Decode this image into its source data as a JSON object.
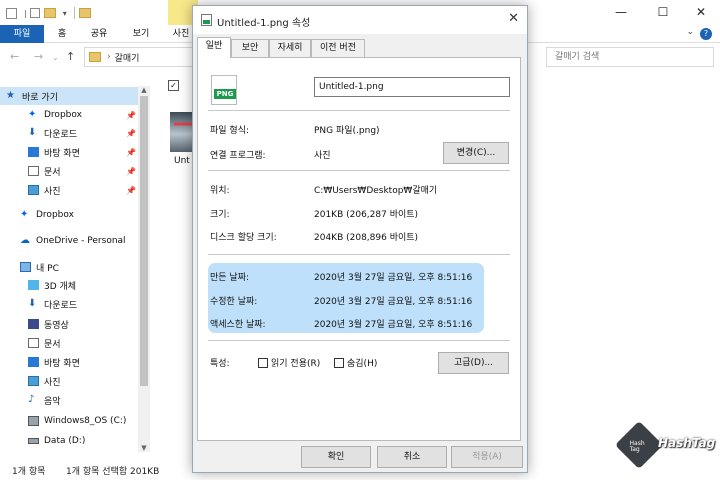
{
  "explorer": {
    "ribbon_tabs": [
      "파일",
      "홈",
      "공유",
      "보기",
      "사진"
    ],
    "address_crumb": "갈매기",
    "search_placeholder": "갈매기 검색",
    "nav": {
      "quick_access": "바로 가기",
      "quick_items": [
        "Dropbox",
        "다운로드",
        "바탕 화면",
        "문서",
        "사진"
      ],
      "dropbox": "Dropbox",
      "onedrive": "OneDrive - Personal",
      "this_pc": "내 PC",
      "pc_items": [
        "3D 개체",
        "다운로드",
        "동영상",
        "문서",
        "바탕 화면",
        "사진",
        "음악",
        "Windows8_OS (C:)",
        "Data (D:)"
      ]
    },
    "file_thumb_label": "Unt",
    "status": {
      "count": "1개 항목",
      "selection": "1개 항목 선택함 201KB"
    }
  },
  "dialog": {
    "title": "Untitled-1.png 속성",
    "tabs": [
      "일반",
      "보안",
      "자세히",
      "이전 버전"
    ],
    "file_name": "Untitled-1.png",
    "icon_text": "PNG",
    "file_type_label": "파일 형식:",
    "file_type_value": "PNG 파일(.png)",
    "opens_with_label": "연결 프로그램:",
    "opens_with_value": "사진",
    "change_button": "변경(C)...",
    "location_label": "위치:",
    "location_value": "C:₩Users₩Desktop₩갈매기",
    "size_label": "크기:",
    "size_value": "201KB (206,287 바이트)",
    "disk_size_label": "디스크 할당 크기:",
    "disk_size_value": "204KB (208,896 바이트)",
    "created_label": "만든 날짜:",
    "created_value": "2020년 3월 27일 금요일, 오후 8:51:16",
    "modified_label": "수정한 날짜:",
    "modified_value": "2020년 3월 27일 금요일, 오후 8:51:16",
    "accessed_label": "액세스한 날짜:",
    "accessed_value": "2020년 3월 27일 금요일, 오후 8:51:16",
    "attributes_label": "특성:",
    "readonly_label": "읽기 전용(R)",
    "hidden_label": "숨김(H)",
    "advanced_button": "고급(D)...",
    "ok_button": "확인",
    "cancel_button": "취소",
    "apply_button": "적용(A)"
  },
  "watermark": {
    "text": "HashTag",
    "cube_text": "Hash\nTag"
  },
  "colors": {
    "accent": "#1a63b5",
    "highlight": "#bfe0fb",
    "annotation_arrow": "#e0404a",
    "png_green": "#1e9a4e"
  }
}
